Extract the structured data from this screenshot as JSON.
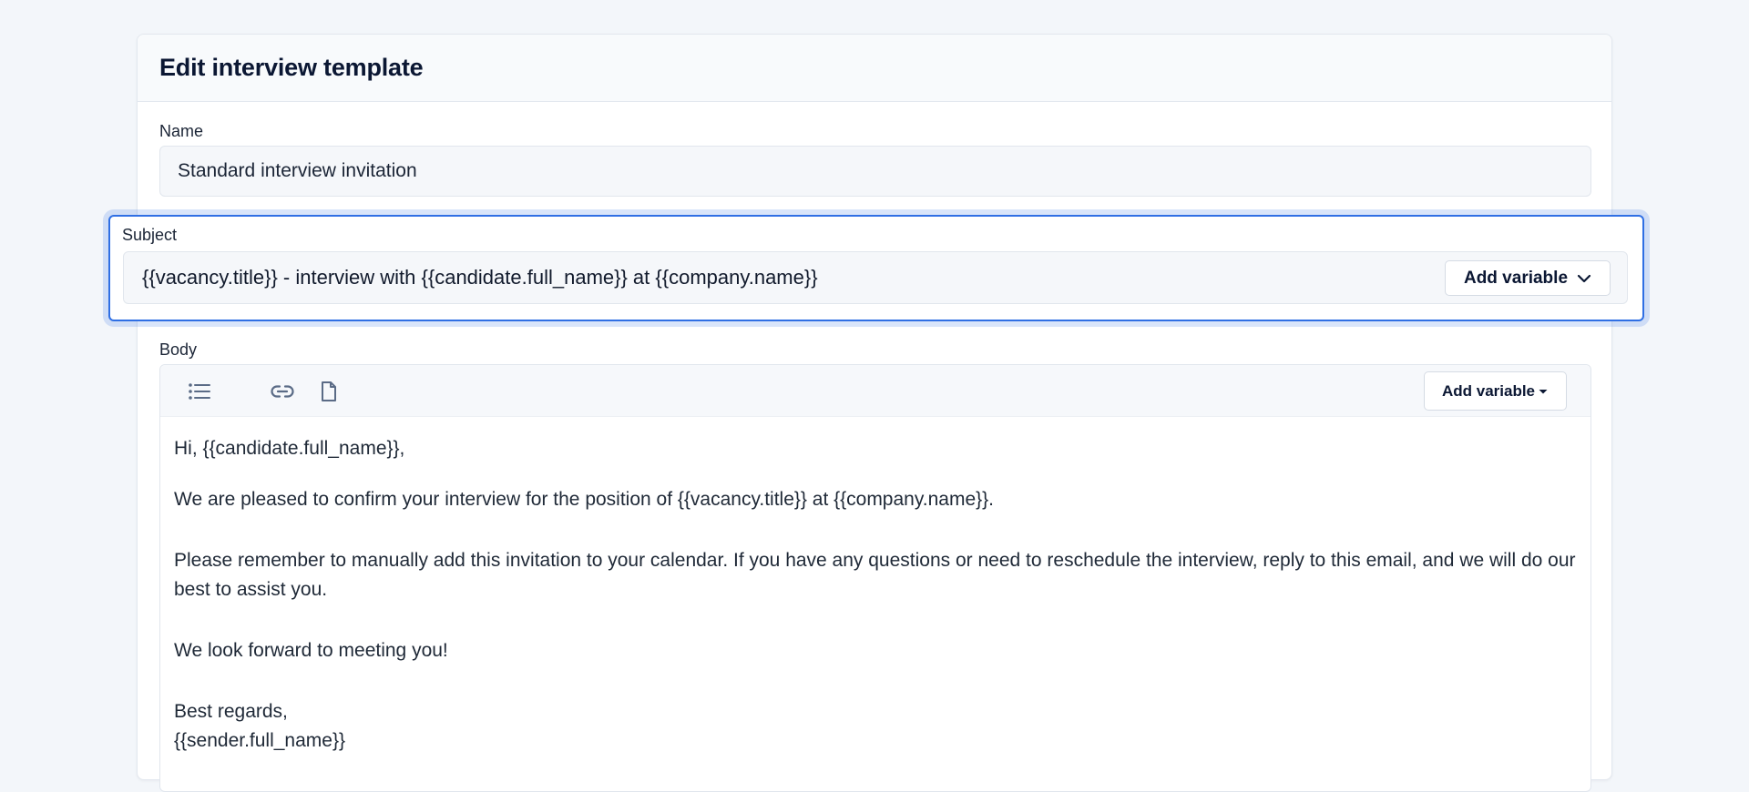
{
  "page": {
    "title": "Edit interview template"
  },
  "fields": {
    "name": {
      "label": "Name",
      "value": "Standard interview invitation"
    },
    "subject": {
      "label": "Subject",
      "value": "{{vacancy.title}} - interview with {{candidate.full_name}} at {{company.name}}",
      "add_variable_label": "Add variable",
      "add_variable_icon": "chevron-down-icon"
    },
    "body": {
      "label": "Body",
      "toolbar": {
        "icons": [
          "bulleted-list-icon",
          "link-icon",
          "document-icon"
        ],
        "add_variable_label": "Add variable",
        "add_variable_icon": "caret-down-icon"
      },
      "lines": [
        "Hi, {{candidate.full_name}},",
        "We are pleased to confirm your interview for the position of {{vacancy.title}} at {{company.name}}.",
        "Please remember to manually add this invitation to your calendar. If you have any questions or need to reschedule the interview, reply to this email, and we will do our best to assist you.",
        "We look forward to meeting you!",
        "Best regards,",
        "{{sender.full_name}}"
      ]
    }
  },
  "colors": {
    "accent": "#2f6fe4",
    "background": "#f3f6fa",
    "icon": "#5a6b86"
  }
}
